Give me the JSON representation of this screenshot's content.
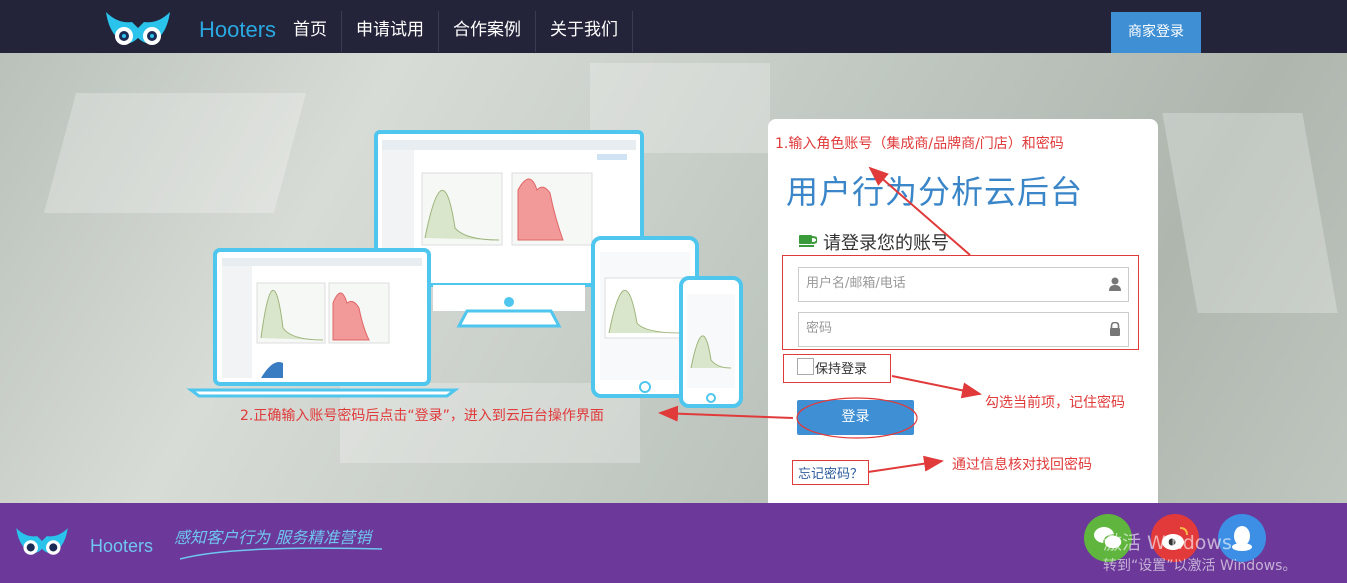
{
  "nav": {
    "brand": "Hooters",
    "items": [
      "首页",
      "申请试用",
      "合作案例",
      "关于我们"
    ],
    "merchant_login": "商家登录"
  },
  "login": {
    "title": "用户行为分析云后台",
    "subtitle": "请登录您的账号",
    "username_placeholder": "用户名/邮箱/电话",
    "password_placeholder": "密码",
    "remember_label": "保持登录",
    "login_button": "登录",
    "forgot_link": "忘记密码？"
  },
  "annotations": {
    "step1": "1.输入角色账号（集成商/品牌商/门店）和密码",
    "step2": "2.正确输入账号密码后点击“登录”，进入到云后台操作界面",
    "remember": "勾选当前项，记住密码",
    "forgot": "通过信息核对找回密码"
  },
  "footer": {
    "brand": "Hooters",
    "slogan": "感知客户行为 服务精准营销"
  },
  "watermark": {
    "line1": "激活 Windows",
    "line2": "转到“设置”以激活 Windows。"
  },
  "colors": {
    "nav_bg": "#23233a",
    "accent_blue": "#3f8fd4",
    "footer_bg": "#6c3899",
    "annotation_red": "#e03a3a"
  }
}
